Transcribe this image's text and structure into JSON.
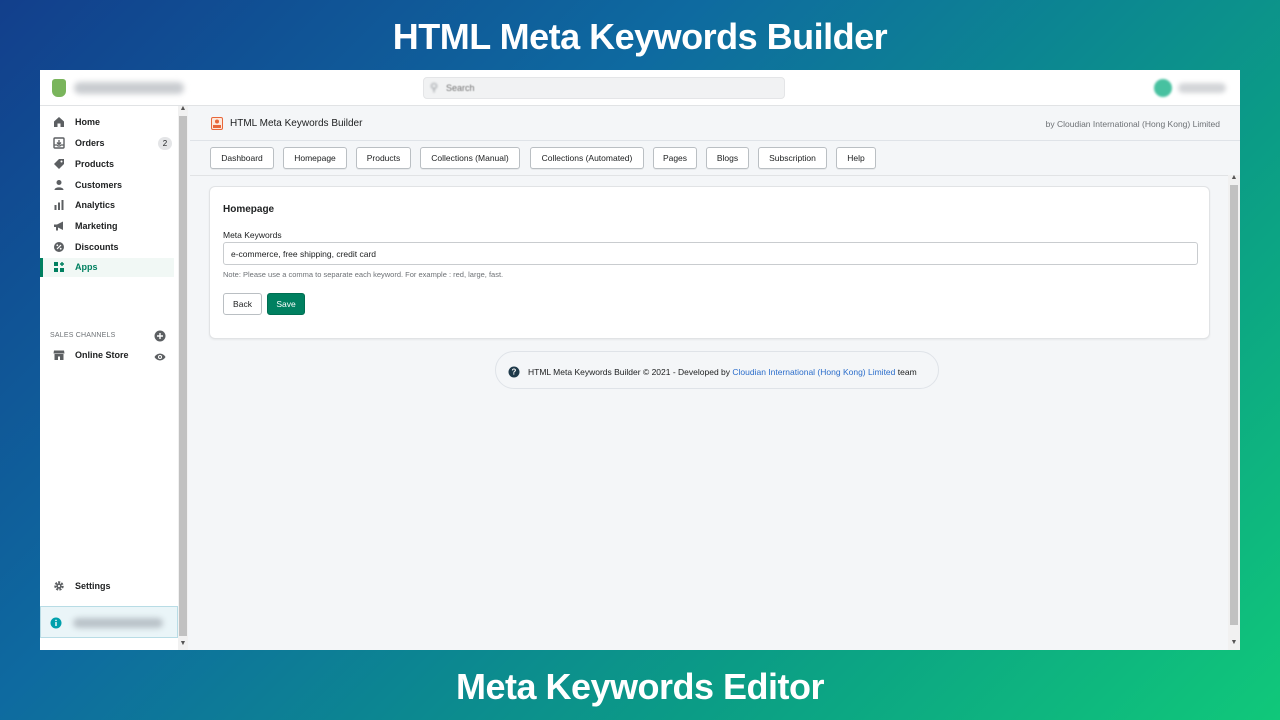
{
  "banner": {
    "top_title": "HTML Meta Keywords Builder",
    "bottom_title": "Meta Keywords Editor"
  },
  "topbar": {
    "search_placeholder": "Search"
  },
  "sidebar": {
    "items": [
      {
        "label": "Home",
        "icon": "home-icon"
      },
      {
        "label": "Orders",
        "icon": "orders-icon",
        "badge": "2"
      },
      {
        "label": "Products",
        "icon": "tag-icon"
      },
      {
        "label": "Customers",
        "icon": "person-icon"
      },
      {
        "label": "Analytics",
        "icon": "bar-chart-icon"
      },
      {
        "label": "Marketing",
        "icon": "megaphone-icon"
      },
      {
        "label": "Discounts",
        "icon": "discount-icon"
      },
      {
        "label": "Apps",
        "icon": "apps-icon",
        "active": true
      }
    ],
    "sales_channels_label": "SALES CHANNELS",
    "online_store_label": "Online Store",
    "settings_label": "Settings"
  },
  "app": {
    "title": "HTML Meta Keywords Builder",
    "byline": "by Cloudian International (Hong Kong) Limited",
    "tabs": [
      "Dashboard",
      "Homepage",
      "Products",
      "Collections (Manual)",
      "Collections (Automated)",
      "Pages",
      "Blogs",
      "Subscription",
      "Help"
    ]
  },
  "card": {
    "title": "Homepage",
    "field_label": "Meta Keywords",
    "field_value": "e-commerce, free shipping, credit card",
    "note": "Note: Please use a comma to separate each keyword. For example : red, large, fast.",
    "back_label": "Back",
    "save_label": "Save"
  },
  "footer": {
    "prefix": "HTML Meta Keywords Builder © 2021 - Developed by ",
    "link": "Cloudian International (Hong Kong) Limited",
    "suffix": " team"
  },
  "colors": {
    "accent": "#008060",
    "link": "#2c6ecb"
  }
}
